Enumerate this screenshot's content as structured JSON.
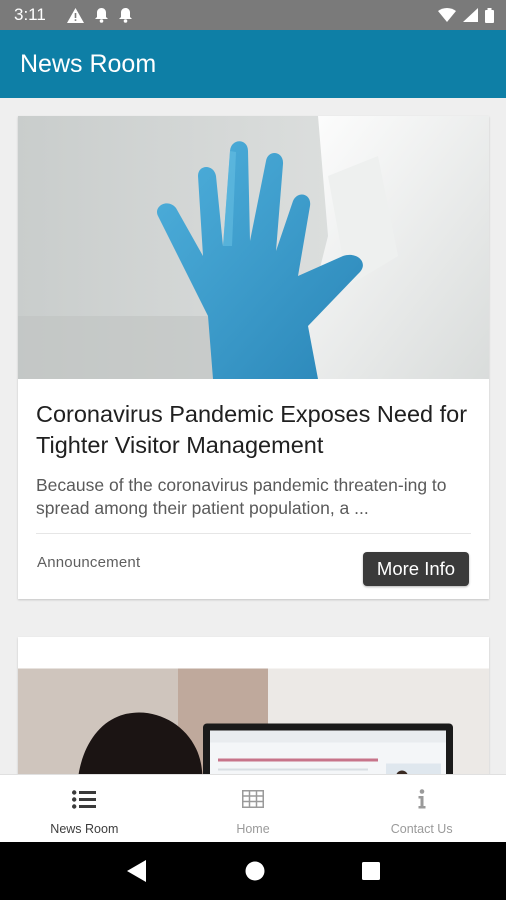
{
  "status_bar": {
    "time": "3:11",
    "icons": [
      "warning-icon",
      "notification-bell-icon",
      "notification-bell-icon",
      "wifi-icon",
      "signal-icon",
      "battery-icon"
    ]
  },
  "app_bar": {
    "title": "News Room"
  },
  "articles": [
    {
      "image": "blue-gloved-hand-stop-gesture",
      "title": "Coronavirus Pandemic Exposes Need for Tighter Visitor Management",
      "summary": "Because of the coronavirus pandemic threaten-ing to spread among their patient population, a ...",
      "category": "Announcement",
      "button_label": "More Info"
    },
    {
      "image": "woman-at-computer-video-call"
    }
  ],
  "bottom_nav": {
    "items": [
      {
        "label": "News Room",
        "icon": "list-icon",
        "active": true
      },
      {
        "label": "Home",
        "icon": "grid-icon",
        "active": false
      },
      {
        "label": "Contact Us",
        "icon": "info-icon",
        "active": false
      }
    ]
  },
  "system_nav": {
    "icons": [
      "back-icon",
      "home-circle-icon",
      "recents-square-icon"
    ]
  },
  "colors": {
    "app_bar": "#0e7fa6",
    "status_bar": "#7a7a7a",
    "button": "#3a3a3a"
  }
}
